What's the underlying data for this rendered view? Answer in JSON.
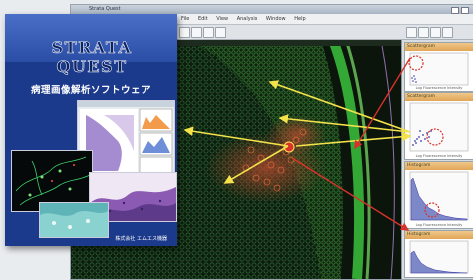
{
  "app": {
    "window_title": "Strata Quest",
    "menu": [
      "File",
      "Edit",
      "View",
      "Analysis",
      "Window",
      "Help"
    ]
  },
  "side_panels": [
    {
      "title": "Scattergram",
      "caption": "Log Fluorescence Intensity"
    },
    {
      "title": "Scattergram",
      "caption": "Log Fluorescence Intensity"
    },
    {
      "title": "Histogram",
      "caption": "Log Fluorescence Intensity"
    },
    {
      "title": "Histogram",
      "caption": "Log Fluorescence Intensity"
    }
  ],
  "brochure": {
    "logo": "STRATA QUEST",
    "subtitle": "病理画像解析ソフトウェア",
    "footer": "株式会社 エムエス機器"
  },
  "colors": {
    "brochure_blue": "#1c3a8c",
    "arrow_yellow": "#f3e24a",
    "highlight_red": "#d8322a",
    "tissue_green": "#35b43c"
  }
}
